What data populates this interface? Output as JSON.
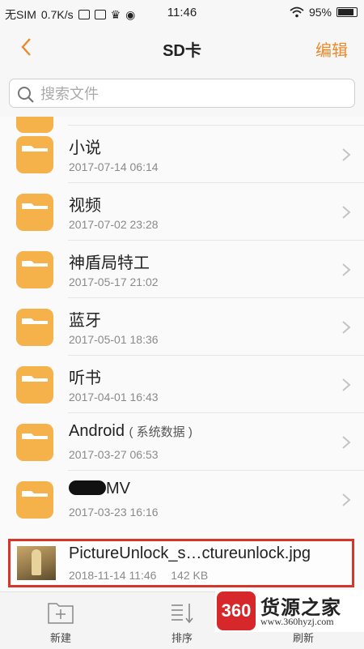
{
  "status_bar": {
    "carrier": "无SIM",
    "speed": "0.7K/s",
    "time": "11:46",
    "battery": "95%"
  },
  "header": {
    "title": "SD卡",
    "edit_label": "编辑"
  },
  "search": {
    "placeholder": "搜索文件"
  },
  "folders": [
    {
      "name": "小说",
      "date": "2017-07-14 06:14"
    },
    {
      "name": "视频",
      "date": "2017-07-02 23:28"
    },
    {
      "name": "神盾局特工",
      "date": "2017-05-17 21:02"
    },
    {
      "name": "蓝牙",
      "date": "2017-05-01 18:36"
    },
    {
      "name": "听书",
      "date": "2017-04-01 16:43"
    },
    {
      "name": "Android",
      "tag": "( 系统数据 )",
      "date": "2017-03-27 06:53"
    },
    {
      "name": "MV",
      "date": "2017-03-23 16:16"
    }
  ],
  "file": {
    "name": "PictureUnlock_s…ctureunlock.jpg",
    "date": "2018-11-14 11:46",
    "size": "142 KB"
  },
  "bottom_bar": {
    "new_label": "新建",
    "sort_label": "排序",
    "refresh_label": "刷新"
  },
  "watermark": {
    "logo": "360",
    "name": "货源之家",
    "url": "www.360hyzj.com"
  },
  "colors": {
    "accent": "#e98b2a",
    "folder": "#f6b24a",
    "highlight_border": "#d8342a"
  }
}
